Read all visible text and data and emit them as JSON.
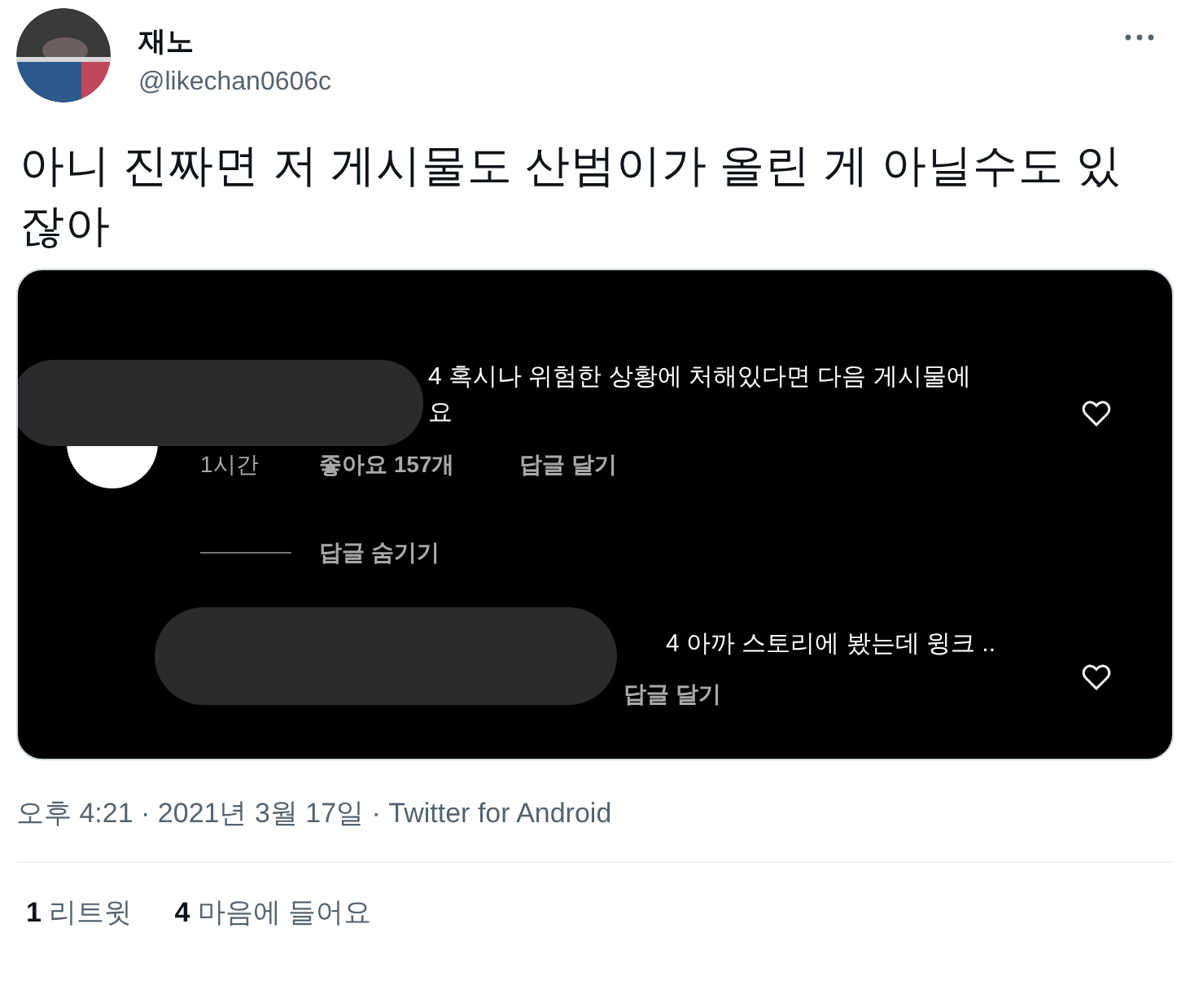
{
  "author": {
    "name": "재노",
    "handle": "@likechan0606c"
  },
  "tweet_text": "아니 진짜면 저 게시물도 산범이가 올린 게 아닐수도 있잖아",
  "embedded_screenshot": {
    "comments": [
      {
        "text_lines": [
          "4 혹시나 위험한 상황에 처해있다면 다음 게시물에",
          "요"
        ],
        "time": "1시간",
        "likes": "좋아요 157개",
        "reply": "답글 달기",
        "liked": false
      },
      {
        "text_lines": [
          "4 아까 스토리에 봤는데 윙크 .."
        ],
        "reply": "답글 달기",
        "liked": false
      }
    ],
    "hide_replies": "답글 숨기기"
  },
  "timestamp": "오후 4:21 · 2021년 3월 17일 · Twitter for Android",
  "stats": [
    {
      "count": "1",
      "label": "리트윗"
    },
    {
      "count": "4",
      "label": "마음에 들어요"
    }
  ]
}
